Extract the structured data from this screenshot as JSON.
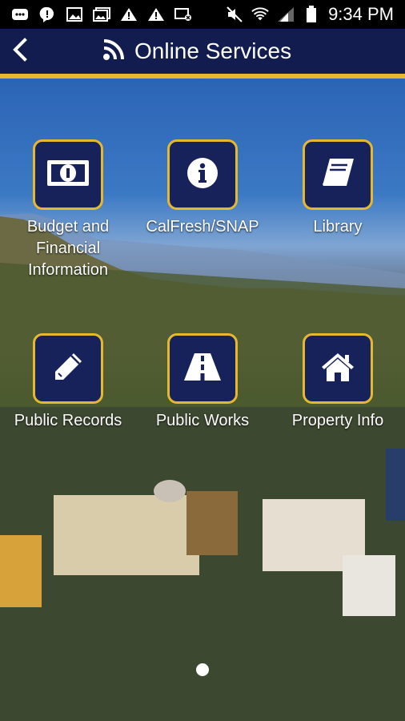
{
  "status_bar": {
    "time": "9:34 PM",
    "icons": [
      "messaging-icon",
      "chat-icon",
      "image-icon",
      "gallery-icon",
      "warning-icon",
      "warning-icon",
      "image-off-icon",
      "mute-icon",
      "wifi-icon",
      "signal-icon",
      "battery-icon"
    ]
  },
  "app_bar": {
    "title": "Online Services",
    "back_icon": "back-arrow-icon",
    "title_icon": "rss-icon",
    "accent_color": "#e5b830",
    "bar_color": "#131c4e"
  },
  "services": [
    {
      "label": "Budget and Financial Information",
      "icon": "money-bill-icon"
    },
    {
      "label": "CalFresh/SNAP",
      "icon": "info-icon"
    },
    {
      "label": "Library",
      "icon": "book-icon"
    },
    {
      "label": "Public Records",
      "icon": "pencil-icon"
    },
    {
      "label": "Public Works",
      "icon": "road-icon"
    },
    {
      "label": "Property Info",
      "icon": "home-icon"
    }
  ],
  "pager": {
    "current_page": 1,
    "page_count": 1
  }
}
